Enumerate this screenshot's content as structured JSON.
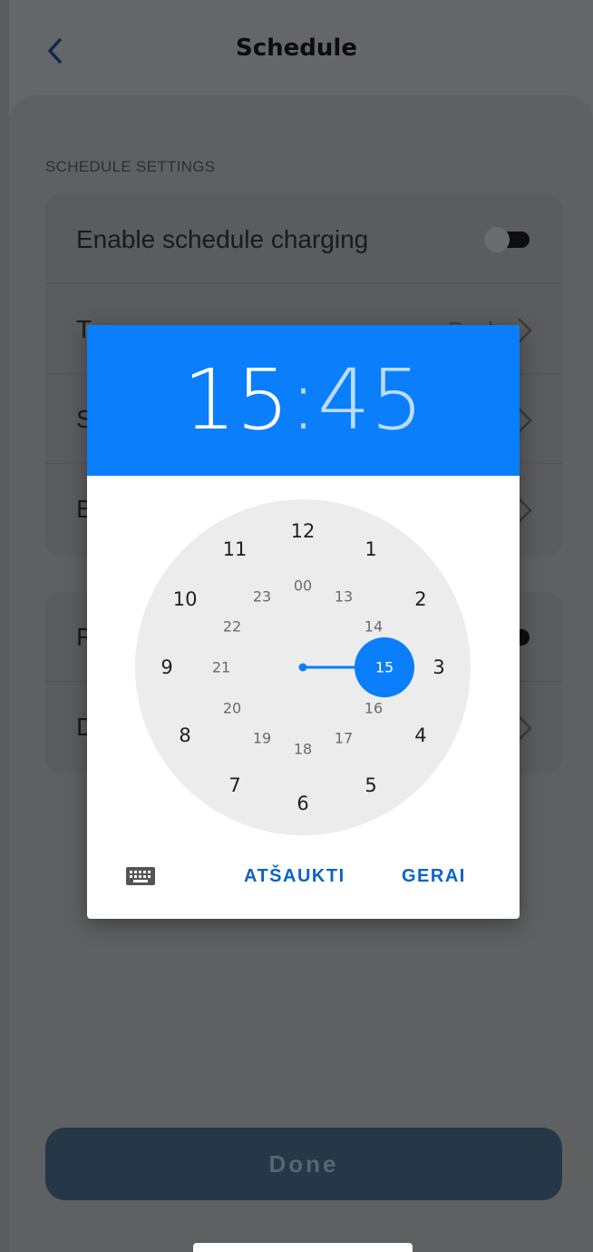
{
  "header": {
    "title": "Schedule",
    "back_icon": "chevron-left-icon"
  },
  "settings": {
    "section_title": "SCHEDULE SETTINGS",
    "card1": [
      {
        "label": "Enable schedule charging",
        "control": "toggle",
        "on": false
      },
      {
        "label": "T",
        "value": "P...d",
        "control": "chevron"
      },
      {
        "label": "S",
        "control": "chevron"
      },
      {
        "label": "E",
        "control": "chevron"
      }
    ],
    "card2": [
      {
        "label": "R",
        "control": "toggle",
        "on": false
      },
      {
        "label": "D",
        "control": "chevron"
      }
    ]
  },
  "done_label": "Done",
  "picker": {
    "hour": "15",
    "separator": ":",
    "minute": "45",
    "selected_hour": "15",
    "outer_numbers": [
      "12",
      "1",
      "2",
      "3",
      "4",
      "5",
      "6",
      "7",
      "8",
      "9",
      "10",
      "11"
    ],
    "inner_numbers": [
      "00",
      "13",
      "14",
      "15",
      "16",
      "17",
      "18",
      "19",
      "20",
      "21",
      "22",
      "23"
    ],
    "keyboard_icon": "keyboard-icon",
    "cancel_label": "ATŠAUKTI",
    "ok_label": "GERAI",
    "colors": {
      "accent": "#0a7efb",
      "header_text": "#ffffff",
      "button_text": "#0b63c5"
    }
  }
}
